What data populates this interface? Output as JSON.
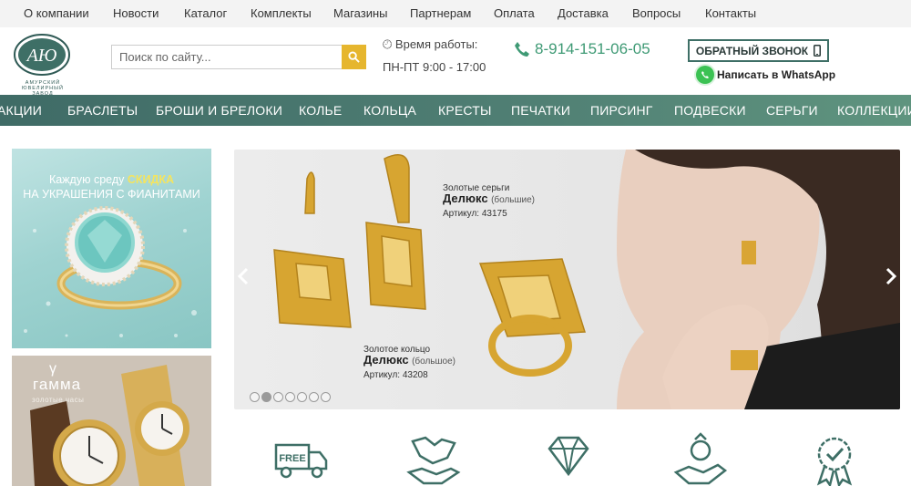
{
  "colors": {
    "accent": "#e6b62e",
    "brand": "#3e6f66",
    "phone": "#3f9a75",
    "whatsapp": "#3bc253"
  },
  "topnav": [
    "О компании",
    "Новости",
    "Каталог",
    "Комплекты",
    "Магазины",
    "Партнерам",
    "Оплата",
    "Доставка",
    "Вопросы",
    "Контакты"
  ],
  "header": {
    "logo_monogram": "АЮ",
    "logo_text": "АМУРСКИЙ ЮВЕЛИРНЫЙ ЗАВОД",
    "search_placeholder": "Поиск по сайту...",
    "hours_title": "Время работы:",
    "hours_value": "ПН-ПТ 9:00 - 17:00",
    "phone": "8-914-151-06-05",
    "callback_label": "ОБРАТНЫЙ ЗВОНОК",
    "whatsapp_label": "Написать в WhatsApp"
  },
  "categories": [
    "АКЦИИ",
    "БРАСЛЕТЫ",
    "БРОШИ И БРЕЛОКИ",
    "КОЛЬЕ",
    "КОЛЬЦА",
    "КРЕСТЫ",
    "ПЕЧАТКИ",
    "ПИРСИНГ",
    "ПОДВЕСКИ",
    "СЕРЬГИ",
    "КОЛЛЕКЦИИ"
  ],
  "banner1": {
    "prefix": "Каждую среду ",
    "highlight": "СКИДКА",
    "line2": "НА УКРАШЕНИЯ С ФИАНИТАМИ"
  },
  "banner2": {
    "symbol": "γ",
    "title": "гамма",
    "subtitle": "золотые часы"
  },
  "slider": {
    "caption1": {
      "type": "Золотые серьги",
      "name": "Делюкс",
      "size": "(большие)",
      "article": "Артикул: 43175"
    },
    "caption2": {
      "type": "Золотое кольцо",
      "name": "Делюкс",
      "size": "(большое)",
      "article": "Артикул: 43208"
    },
    "dots_total": 7,
    "active_dot": 2
  },
  "features": [
    {
      "icon": "free-delivery-icon",
      "label": "FREE"
    },
    {
      "icon": "handshake-icon"
    },
    {
      "icon": "diamond-icon"
    },
    {
      "icon": "ring-gift-icon"
    },
    {
      "icon": "quality-badge-icon"
    }
  ]
}
